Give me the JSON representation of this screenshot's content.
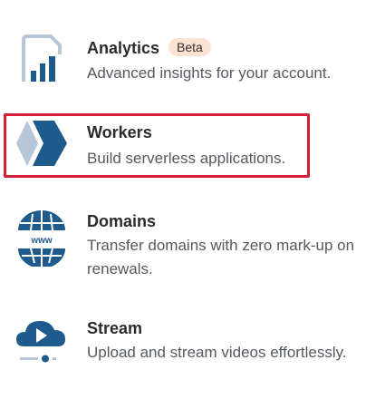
{
  "products": [
    {
      "title": "Analytics",
      "badge": "Beta",
      "desc": "Advanced insights for your account.",
      "icon": "analytics-icon"
    },
    {
      "title": "Workers",
      "desc": "Build serverless applications.",
      "icon": "workers-icon",
      "highlighted": true
    },
    {
      "title": "Domains",
      "desc": "Transfer domains with zero mark-up on renewals.",
      "icon": "domains-icon",
      "icon_text": "www"
    },
    {
      "title": "Stream",
      "desc": "Upload and stream videos effortlessly.",
      "icon": "stream-icon"
    }
  ],
  "colors": {
    "icon_blue": "#1f5a8c",
    "icon_light": "#b7c6d6",
    "highlight": "#d51d34",
    "badge_bg": "#fbe3d4"
  }
}
